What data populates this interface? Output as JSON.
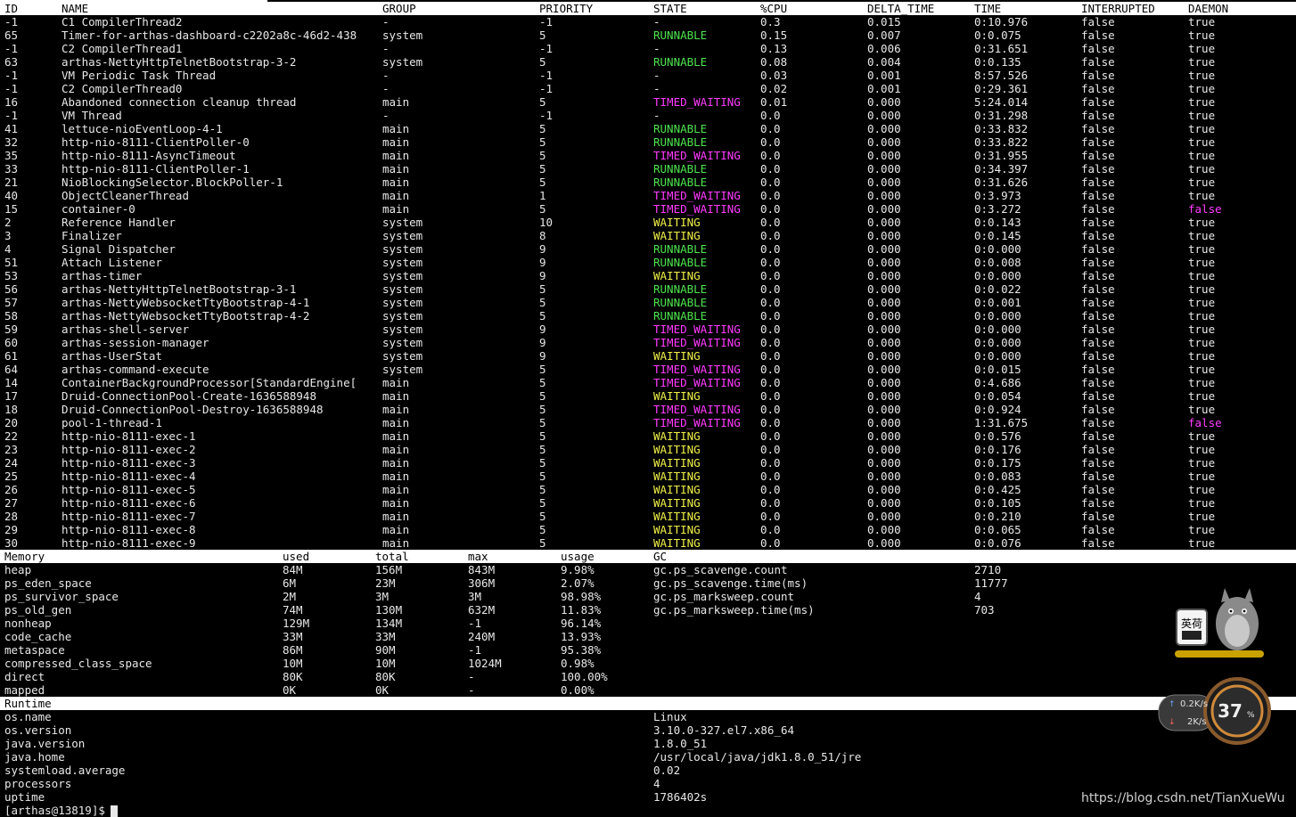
{
  "threads": {
    "headers": [
      "ID",
      "NAME",
      "GROUP",
      "PRIORITY",
      "STATE",
      "%CPU",
      "DELTA_TIME",
      "TIME",
      "INTERRUPTED",
      "DAEMON"
    ],
    "rows": [
      [
        "-1",
        "C1 CompilerThread2",
        "-",
        "-1",
        "-",
        "0.3",
        "0.015",
        "0:10.976",
        "false",
        "true"
      ],
      [
        "65",
        "Timer-for-arthas-dashboard-c2202a8c-46d2-438",
        "system",
        "5",
        "RUNNABLE",
        "0.15",
        "0.007",
        "0:0.075",
        "false",
        "true"
      ],
      [
        "-1",
        "C2 CompilerThread1",
        "-",
        "-1",
        "-",
        "0.13",
        "0.006",
        "0:31.651",
        "false",
        "true"
      ],
      [
        "63",
        "arthas-NettyHttpTelnetBootstrap-3-2",
        "system",
        "5",
        "RUNNABLE",
        "0.08",
        "0.004",
        "0:0.135",
        "false",
        "true"
      ],
      [
        "-1",
        "VM Periodic Task Thread",
        "-",
        "-1",
        "-",
        "0.03",
        "0.001",
        "8:57.526",
        "false",
        "true"
      ],
      [
        "-1",
        "C2 CompilerThread0",
        "-",
        "-1",
        "-",
        "0.02",
        "0.001",
        "0:29.361",
        "false",
        "true"
      ],
      [
        "16",
        "Abandoned connection cleanup thread",
        "main",
        "5",
        "TIMED_WAITING",
        "0.01",
        "0.000",
        "5:24.014",
        "false",
        "true"
      ],
      [
        "-1",
        "VM Thread",
        "-",
        "-1",
        "-",
        "0.0",
        "0.000",
        "0:31.298",
        "false",
        "true"
      ],
      [
        "41",
        "lettuce-nioEventLoop-4-1",
        "main",
        "5",
        "RUNNABLE",
        "0.0",
        "0.000",
        "0:33.832",
        "false",
        "true"
      ],
      [
        "32",
        "http-nio-8111-ClientPoller-0",
        "main",
        "5",
        "RUNNABLE",
        "0.0",
        "0.000",
        "0:33.822",
        "false",
        "true"
      ],
      [
        "35",
        "http-nio-8111-AsyncTimeout",
        "main",
        "5",
        "TIMED_WAITING",
        "0.0",
        "0.000",
        "0:31.955",
        "false",
        "true"
      ],
      [
        "33",
        "http-nio-8111-ClientPoller-1",
        "main",
        "5",
        "RUNNABLE",
        "0.0",
        "0.000",
        "0:34.397",
        "false",
        "true"
      ],
      [
        "21",
        "NioBlockingSelector.BlockPoller-1",
        "main",
        "5",
        "RUNNABLE",
        "0.0",
        "0.000",
        "0:31.626",
        "false",
        "true"
      ],
      [
        "40",
        "ObjectCleanerThread",
        "main",
        "1",
        "TIMED_WAITING",
        "0.0",
        "0.000",
        "0:3.973",
        "false",
        "true"
      ],
      [
        "15",
        "container-0",
        "main",
        "5",
        "TIMED_WAITING",
        "0.0",
        "0.000",
        "0:3.272",
        "false",
        "false"
      ],
      [
        "2",
        "Reference Handler",
        "system",
        "10",
        "WAITING",
        "0.0",
        "0.000",
        "0:0.143",
        "false",
        "true"
      ],
      [
        "3",
        "Finalizer",
        "system",
        "8",
        "WAITING",
        "0.0",
        "0.000",
        "0:0.145",
        "false",
        "true"
      ],
      [
        "4",
        "Signal Dispatcher",
        "system",
        "9",
        "RUNNABLE",
        "0.0",
        "0.000",
        "0:0.000",
        "false",
        "true"
      ],
      [
        "51",
        "Attach Listener",
        "system",
        "9",
        "RUNNABLE",
        "0.0",
        "0.000",
        "0:0.008",
        "false",
        "true"
      ],
      [
        "53",
        "arthas-timer",
        "system",
        "9",
        "WAITING",
        "0.0",
        "0.000",
        "0:0.000",
        "false",
        "true"
      ],
      [
        "56",
        "arthas-NettyHttpTelnetBootstrap-3-1",
        "system",
        "5",
        "RUNNABLE",
        "0.0",
        "0.000",
        "0:0.022",
        "false",
        "true"
      ],
      [
        "57",
        "arthas-NettyWebsocketTtyBootstrap-4-1",
        "system",
        "5",
        "RUNNABLE",
        "0.0",
        "0.000",
        "0:0.001",
        "false",
        "true"
      ],
      [
        "58",
        "arthas-NettyWebsocketTtyBootstrap-4-2",
        "system",
        "5",
        "RUNNABLE",
        "0.0",
        "0.000",
        "0:0.000",
        "false",
        "true"
      ],
      [
        "59",
        "arthas-shell-server",
        "system",
        "9",
        "TIMED_WAITING",
        "0.0",
        "0.000",
        "0:0.000",
        "false",
        "true"
      ],
      [
        "60",
        "arthas-session-manager",
        "system",
        "9",
        "TIMED_WAITING",
        "0.0",
        "0.000",
        "0:0.000",
        "false",
        "true"
      ],
      [
        "61",
        "arthas-UserStat",
        "system",
        "9",
        "WAITING",
        "0.0",
        "0.000",
        "0:0.000",
        "false",
        "true"
      ],
      [
        "64",
        "arthas-command-execute",
        "system",
        "5",
        "TIMED_WAITING",
        "0.0",
        "0.000",
        "0:0.015",
        "false",
        "true"
      ],
      [
        "14",
        "ContainerBackgroundProcessor[StandardEngine[",
        "main",
        "5",
        "TIMED_WAITING",
        "0.0",
        "0.000",
        "0:4.686",
        "false",
        "true"
      ],
      [
        "17",
        "Druid-ConnectionPool-Create-1636588948",
        "main",
        "5",
        "WAITING",
        "0.0",
        "0.000",
        "0:0.054",
        "false",
        "true"
      ],
      [
        "18",
        "Druid-ConnectionPool-Destroy-1636588948",
        "main",
        "5",
        "TIMED_WAITING",
        "0.0",
        "0.000",
        "0:0.924",
        "false",
        "true"
      ],
      [
        "20",
        "pool-1-thread-1",
        "main",
        "5",
        "TIMED_WAITING",
        "0.0",
        "0.000",
        "1:31.675",
        "false",
        "false"
      ],
      [
        "22",
        "http-nio-8111-exec-1",
        "main",
        "5",
        "WAITING",
        "0.0",
        "0.000",
        "0:0.576",
        "false",
        "true"
      ],
      [
        "23",
        "http-nio-8111-exec-2",
        "main",
        "5",
        "WAITING",
        "0.0",
        "0.000",
        "0:0.176",
        "false",
        "true"
      ],
      [
        "24",
        "http-nio-8111-exec-3",
        "main",
        "5",
        "WAITING",
        "0.0",
        "0.000",
        "0:0.175",
        "false",
        "true"
      ],
      [
        "25",
        "http-nio-8111-exec-4",
        "main",
        "5",
        "WAITING",
        "0.0",
        "0.000",
        "0:0.083",
        "false",
        "true"
      ],
      [
        "26",
        "http-nio-8111-exec-5",
        "main",
        "5",
        "WAITING",
        "0.0",
        "0.000",
        "0:0.425",
        "false",
        "true"
      ],
      [
        "27",
        "http-nio-8111-exec-6",
        "main",
        "5",
        "WAITING",
        "0.0",
        "0.000",
        "0:0.105",
        "false",
        "true"
      ],
      [
        "28",
        "http-nio-8111-exec-7",
        "main",
        "5",
        "WAITING",
        "0.0",
        "0.000",
        "0:0.210",
        "false",
        "true"
      ],
      [
        "29",
        "http-nio-8111-exec-8",
        "main",
        "5",
        "WAITING",
        "0.0",
        "0.000",
        "0:0.065",
        "false",
        "true"
      ],
      [
        "30",
        "http-nio-8111-exec-9",
        "main",
        "5",
        "WAITING",
        "0.0",
        "0.000",
        "0:0.076",
        "false",
        "true"
      ]
    ]
  },
  "memory": {
    "headers": [
      "Memory",
      "used",
      "total",
      "max",
      "usage",
      "GC"
    ],
    "rows": [
      [
        "heap",
        "84M",
        "156M",
        "843M",
        "9.98%"
      ],
      [
        "ps_eden_space",
        "6M",
        "23M",
        "306M",
        "2.07%"
      ],
      [
        "ps_survivor_space",
        "2M",
        "3M",
        "3M",
        "98.98%"
      ],
      [
        "ps_old_gen",
        "74M",
        "130M",
        "632M",
        "11.83%"
      ],
      [
        "nonheap",
        "129M",
        "134M",
        "-1",
        "96.14%"
      ],
      [
        "code_cache",
        "33M",
        "33M",
        "240M",
        "13.93%"
      ],
      [
        "metaspace",
        "86M",
        "90M",
        "-1",
        "95.38%"
      ],
      [
        "compressed_class_space",
        "10M",
        "10M",
        "1024M",
        "0.98%"
      ],
      [
        "direct",
        "80K",
        "80K",
        "-",
        "100.00%"
      ],
      [
        "mapped",
        "0K",
        "0K",
        "-",
        "0.00%"
      ]
    ],
    "gc": [
      [
        "gc.ps_scavenge.count",
        "2710"
      ],
      [
        "gc.ps_scavenge.time(ms)",
        "11777"
      ],
      [
        "gc.ps_marksweep.count",
        "4"
      ],
      [
        "gc.ps_marksweep.time(ms)",
        "703"
      ]
    ]
  },
  "runtime": {
    "header": "Runtime",
    "rows": [
      [
        "os.name",
        "Linux"
      ],
      [
        "os.version",
        "3.10.0-327.el7.x86_64"
      ],
      [
        "java.version",
        "1.8.0_51"
      ],
      [
        "java.home",
        "/usr/local/java/jdk1.8.0_51/jre"
      ],
      [
        "systemload.average",
        "0.02"
      ],
      [
        "processors",
        "4"
      ],
      [
        "uptime",
        "1786402s"
      ]
    ]
  },
  "prompt": "[arthas@13819]$",
  "overlay": {
    "mascot_label": "英荷",
    "net_up": "0.2K/s",
    "net_down": "2K/s",
    "cpu_percent": "37",
    "percent_sign": "%"
  },
  "watermark": "https://blog.csdn.net/TianXueWu",
  "colors": {
    "RUNNABLE": "#4ee44e",
    "TIMED_WAITING": "#ff3cff",
    "WAITING": "#f0f04a",
    "header_bg": "#ffffff",
    "background": "#000000"
  }
}
